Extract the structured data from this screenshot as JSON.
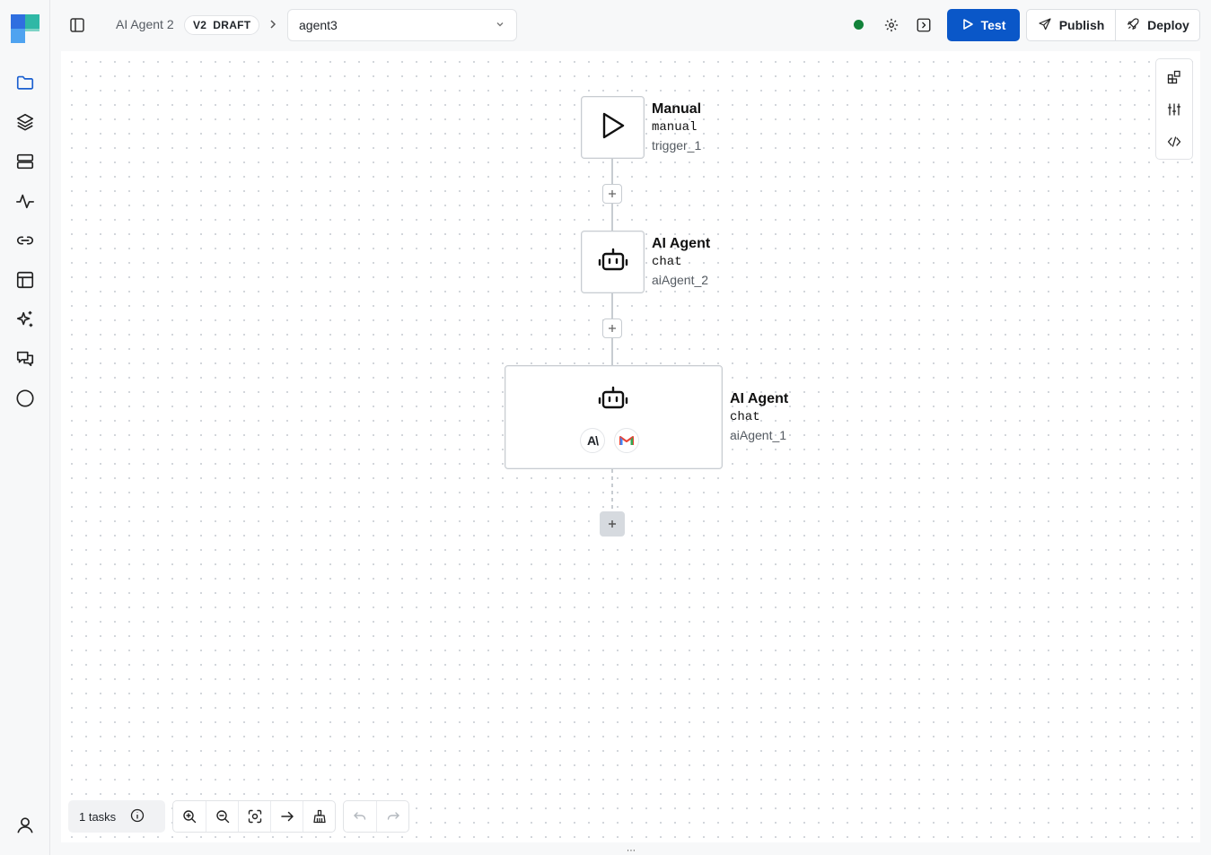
{
  "header": {
    "breadcrumb": "AI Agent 2",
    "version": "V2",
    "status": "DRAFT",
    "agent_select": "agent3",
    "status_color": "#12823a",
    "test_label": "Test",
    "publish_label": "Publish",
    "deploy_label": "Deploy"
  },
  "sidebar": {
    "items": [
      "folder-icon",
      "layers-icon",
      "server-icon",
      "activity-icon",
      "link-icon",
      "table-icon",
      "sparkles-icon",
      "chat-icon",
      "circle-icon"
    ],
    "user": "user-icon"
  },
  "canvas": {
    "nodes": [
      {
        "title": "Manual",
        "type": "manual",
        "id": "trigger_1",
        "icon": "play-icon"
      },
      {
        "title": "AI Agent",
        "type": "chat",
        "id": "aiAgent_2",
        "icon": "bot-icon"
      },
      {
        "title": "AI Agent",
        "type": "chat",
        "id": "aiAgent_1",
        "icon": "bot-icon",
        "tools": [
          "anthropic-icon",
          "gmail-icon"
        ]
      }
    ],
    "anthropic_glyph": "A\\"
  },
  "footer": {
    "tasks": "1 tasks"
  },
  "colors": {
    "accent": "#0a57c8",
    "gmail_red": "#ea4335",
    "gmail_blue": "#4285f4"
  }
}
